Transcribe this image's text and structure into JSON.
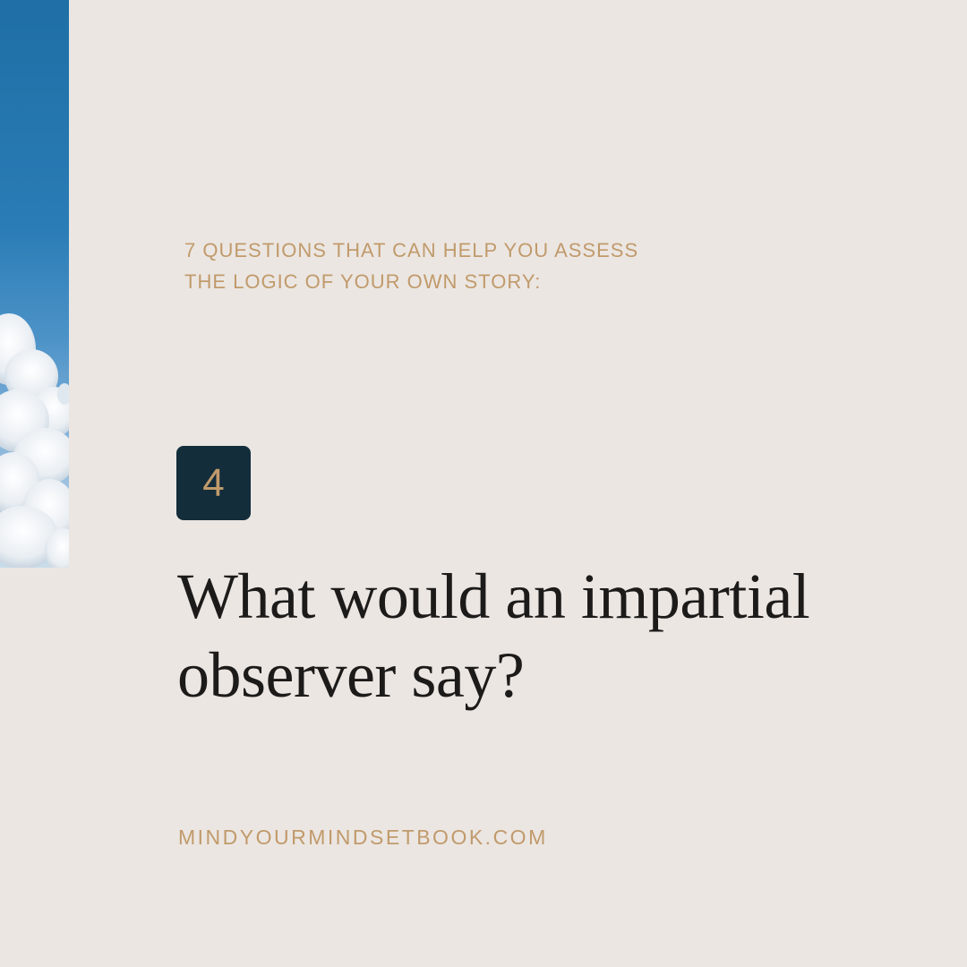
{
  "eyebrow": {
    "line1": "7 QUESTIONS THAT CAN HELP YOU ASSESS",
    "line2": "THE LOGIC OF YOUR OWN STORY:"
  },
  "badge": {
    "number": "4"
  },
  "question": {
    "line1": "What would an impartial",
    "line2": "observer say?"
  },
  "footer": {
    "website": "MINDYOURMINDSETBOOK.COM"
  },
  "colors": {
    "background": "#ebe6e2",
    "accent_gold": "#c19a6b",
    "badge_navy": "#132d3b",
    "text_dark": "#1d1b1a",
    "sky_blue": "#2a7cb6"
  },
  "images": {
    "left_strip": "sky-with-clouds"
  }
}
